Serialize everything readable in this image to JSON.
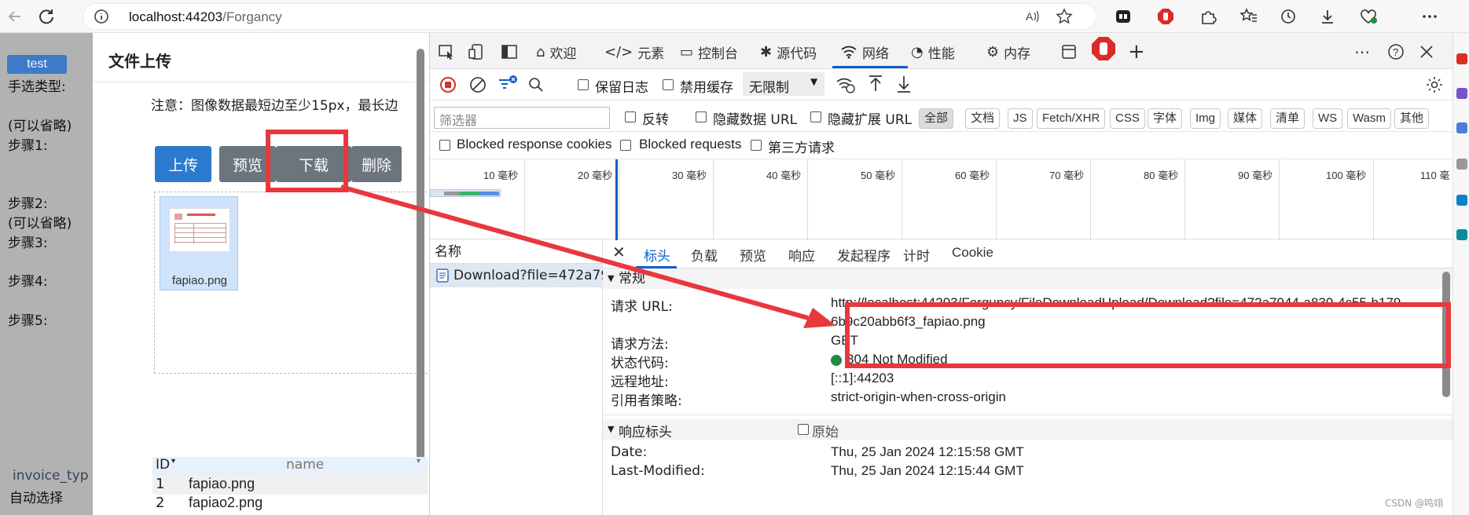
{
  "browser": {
    "url_host": "localhost:44203",
    "url_path": "/Forgancy"
  },
  "left_app": {
    "test_button": "test",
    "lines": [
      "手选类型:",
      "(可以省略)",
      "步骤1:",
      "步骤2:",
      "(可以省略)",
      "步骤3:",
      "步骤4:",
      "步骤5:"
    ],
    "invoice_label": "invoice_typ",
    "auto_select": "自动选择"
  },
  "upload_panel": {
    "title": "文件上传",
    "note": "注意：图像数据最短边至少15px，最长边",
    "buttons": {
      "upload": "上传",
      "preview": "预览",
      "download": "下载",
      "delete": "删除"
    },
    "thumbnail_name": "fapiao.png",
    "table": {
      "headers": [
        "ID",
        "name"
      ],
      "rows": [
        [
          "1",
          "fapiao.png"
        ],
        [
          "2",
          "fapiao2.png"
        ]
      ]
    }
  },
  "devtools": {
    "tabs": [
      "欢迎",
      "元素",
      "控制台",
      "源代码",
      "网络",
      "性能",
      "内存"
    ],
    "active_tab": "网络",
    "toolbar": {
      "preserve_log": "保留日志",
      "disable_cache": "禁用缓存",
      "throttle": "无限制"
    },
    "filter": {
      "placeholder": "筛选器",
      "invert": "反转",
      "hide_data_urls": "隐藏数据 URL",
      "hide_ext_urls": "隐藏扩展 URL",
      "chips": [
        "全部",
        "文档",
        "JS",
        "Fetch/XHR",
        "CSS",
        "字体",
        "Img",
        "媒体",
        "清单",
        "WS",
        "Wasm",
        "其他"
      ]
    },
    "blocked": {
      "cookies": "Blocked response cookies",
      "requests": "Blocked requests",
      "third_party": "第三方请求"
    },
    "timeline_labels": [
      "10 毫秒",
      "20 毫秒",
      "30 毫秒",
      "40 毫秒",
      "50 毫秒",
      "60 毫秒",
      "70 毫秒",
      "80 毫秒",
      "90 毫秒",
      "100 毫秒",
      "110 毫"
    ],
    "name_header": "名称",
    "request_name": "Download?file=472a79...",
    "detail_tabs": [
      "标头",
      "负载",
      "预览",
      "响应",
      "发起程序",
      "计时",
      "Cookie"
    ],
    "general_section": "常规",
    "general": {
      "request_url_key": "请求 URL:",
      "request_url_line1": "http://localhost:44203/Forguncy/FileDownloadUpload/Download?file=472a7944-a830-4c55-b179-",
      "request_url_line2": "6b9c20abb6f3_fapiao.png",
      "method_key": "请求方法:",
      "method_val": "GET",
      "status_key": "状态代码:",
      "status_val": "304 Not Modified",
      "remote_key": "远程地址:",
      "remote_val": "[::1]:44203",
      "referrer_key": "引用者策略:",
      "referrer_val": "strict-origin-when-cross-origin"
    },
    "response_section": "响应标头",
    "raw_label": "原始",
    "response": {
      "date_key": "Date:",
      "date_val": "Thu, 25 Jan 2024 12:15:58 GMT",
      "lastmod_key": "Last-Modified:",
      "lastmod_val": "Thu, 25 Jan 2024 12:15:44 GMT"
    }
  },
  "colors": {
    "annotation_red": "#e8383d",
    "primary_blue": "#2a7bd0",
    "status_green": "#1e8e3e"
  },
  "watermark": "CSDN @鸣翊"
}
